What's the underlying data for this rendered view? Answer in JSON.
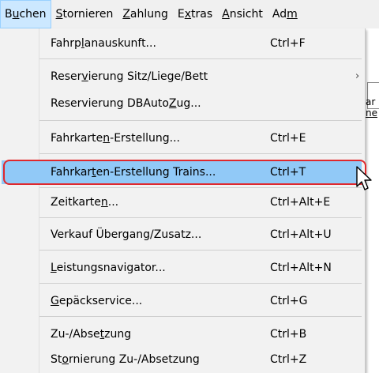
{
  "menubar": {
    "items": [
      {
        "pre": "B",
        "ul": "u",
        "post": "chen",
        "active": true
      },
      {
        "pre": "",
        "ul": "S",
        "post": "tornieren",
        "active": false
      },
      {
        "pre": "",
        "ul": "Z",
        "post": "ahlung",
        "active": false
      },
      {
        "pre": "E",
        "ul": "x",
        "post": "tras",
        "active": false
      },
      {
        "pre": "",
        "ul": "A",
        "post": "nsicht",
        "active": false
      },
      {
        "pre": "Ad",
        "ul": "m",
        "post": "",
        "active": false
      }
    ]
  },
  "dropdown": {
    "items": [
      {
        "pre": "Fahrp",
        "ul": "l",
        "post": "anauskunft...",
        "shortcut": "Ctrl+F"
      },
      {
        "pre": "Reser",
        "ul": "v",
        "post": "ierung Sitz/Liege/Bett",
        "shortcut": "",
        "submenu": true
      },
      {
        "pre": "Reservierung DBAuto",
        "ul": "Z",
        "post": "ug...",
        "shortcut": ""
      },
      {
        "pre": "Fahrkarte",
        "ul": "n",
        "post": "-Erstellung...",
        "shortcut": "Ctrl+E"
      },
      {
        "pre": "Fahrkar",
        "ul": "t",
        "post": "en-Erstellung Trains...",
        "shortcut": "Ctrl+T",
        "highlighted": true
      },
      {
        "pre": "Zeitkarte",
        "ul": "n",
        "post": "...",
        "shortcut": "Ctrl+Alt+E"
      },
      {
        "pre": "Verkauf Übergang/Zusatz...",
        "ul": "",
        "post": "",
        "shortcut": "Ctrl+Alt+U"
      },
      {
        "pre": "",
        "ul": "L",
        "post": "eistungsnavigator...",
        "shortcut": "Ctrl+Alt+N"
      },
      {
        "pre": "",
        "ul": "G",
        "post": "epäckservice...",
        "shortcut": "Ctrl+G"
      },
      {
        "pre": "Zu-/Abse",
        "ul": "t",
        "post": "zung",
        "shortcut": "Ctrl+B"
      },
      {
        "pre": "St",
        "ul": "o",
        "post": "rnierung Zu-/Absetzung",
        "shortcut": "Ctrl+Z"
      }
    ],
    "submenu_arrow": "›"
  },
  "background": {
    "fragment_1": "ar",
    "fragment_2": "ne"
  },
  "colors": {
    "highlight": "#91c9f7",
    "callout": "#e0282d"
  },
  "icons": {
    "cursor": "arrow-cursor-icon"
  }
}
